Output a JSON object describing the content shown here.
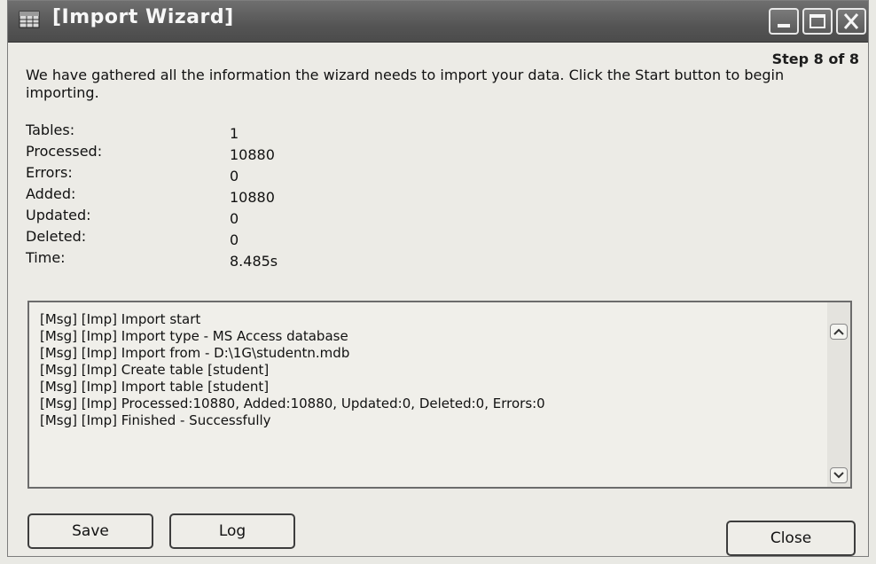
{
  "window": {
    "title": "[Import Wizard]"
  },
  "wizard": {
    "step_text": "Step 8 of 8",
    "intro_text": "We have gathered all the information the wizard needs to import your data. Click the Start button to begin importing."
  },
  "stats": [
    {
      "label": "Tables:",
      "value": "1"
    },
    {
      "label": "Processed:",
      "value": "10880"
    },
    {
      "label": "Errors:",
      "value": "0"
    },
    {
      "label": "Added:",
      "value": "10880"
    },
    {
      "label": "Updated:",
      "value": "0"
    },
    {
      "label": "Deleted:",
      "value": "0"
    },
    {
      "label": "Time:",
      "value": "8.485s"
    }
  ],
  "log_lines": [
    "[Msg] [Imp] Import start",
    "[Msg] [Imp] Import type - MS Access database",
    "[Msg] [Imp] Import from - D:\\1G\\studentn.mdb",
    "[Msg] [Imp] Create table [student]",
    "[Msg] [Imp] Import table [student]",
    "[Msg] [Imp] Processed:10880, Added:10880, Updated:0, Deleted:0, Errors:0",
    "[Msg] [Imp] Finished - Successfully"
  ],
  "buttons": {
    "save": "Save",
    "log": "Log",
    "close": "Close"
  },
  "icons": {
    "app": "table-grid-icon",
    "minimize": "minimize-icon",
    "maximize": "maximize-icon",
    "close": "close-icon",
    "scroll_up": "chevron-up-icon",
    "scroll_down": "chevron-down-icon"
  }
}
